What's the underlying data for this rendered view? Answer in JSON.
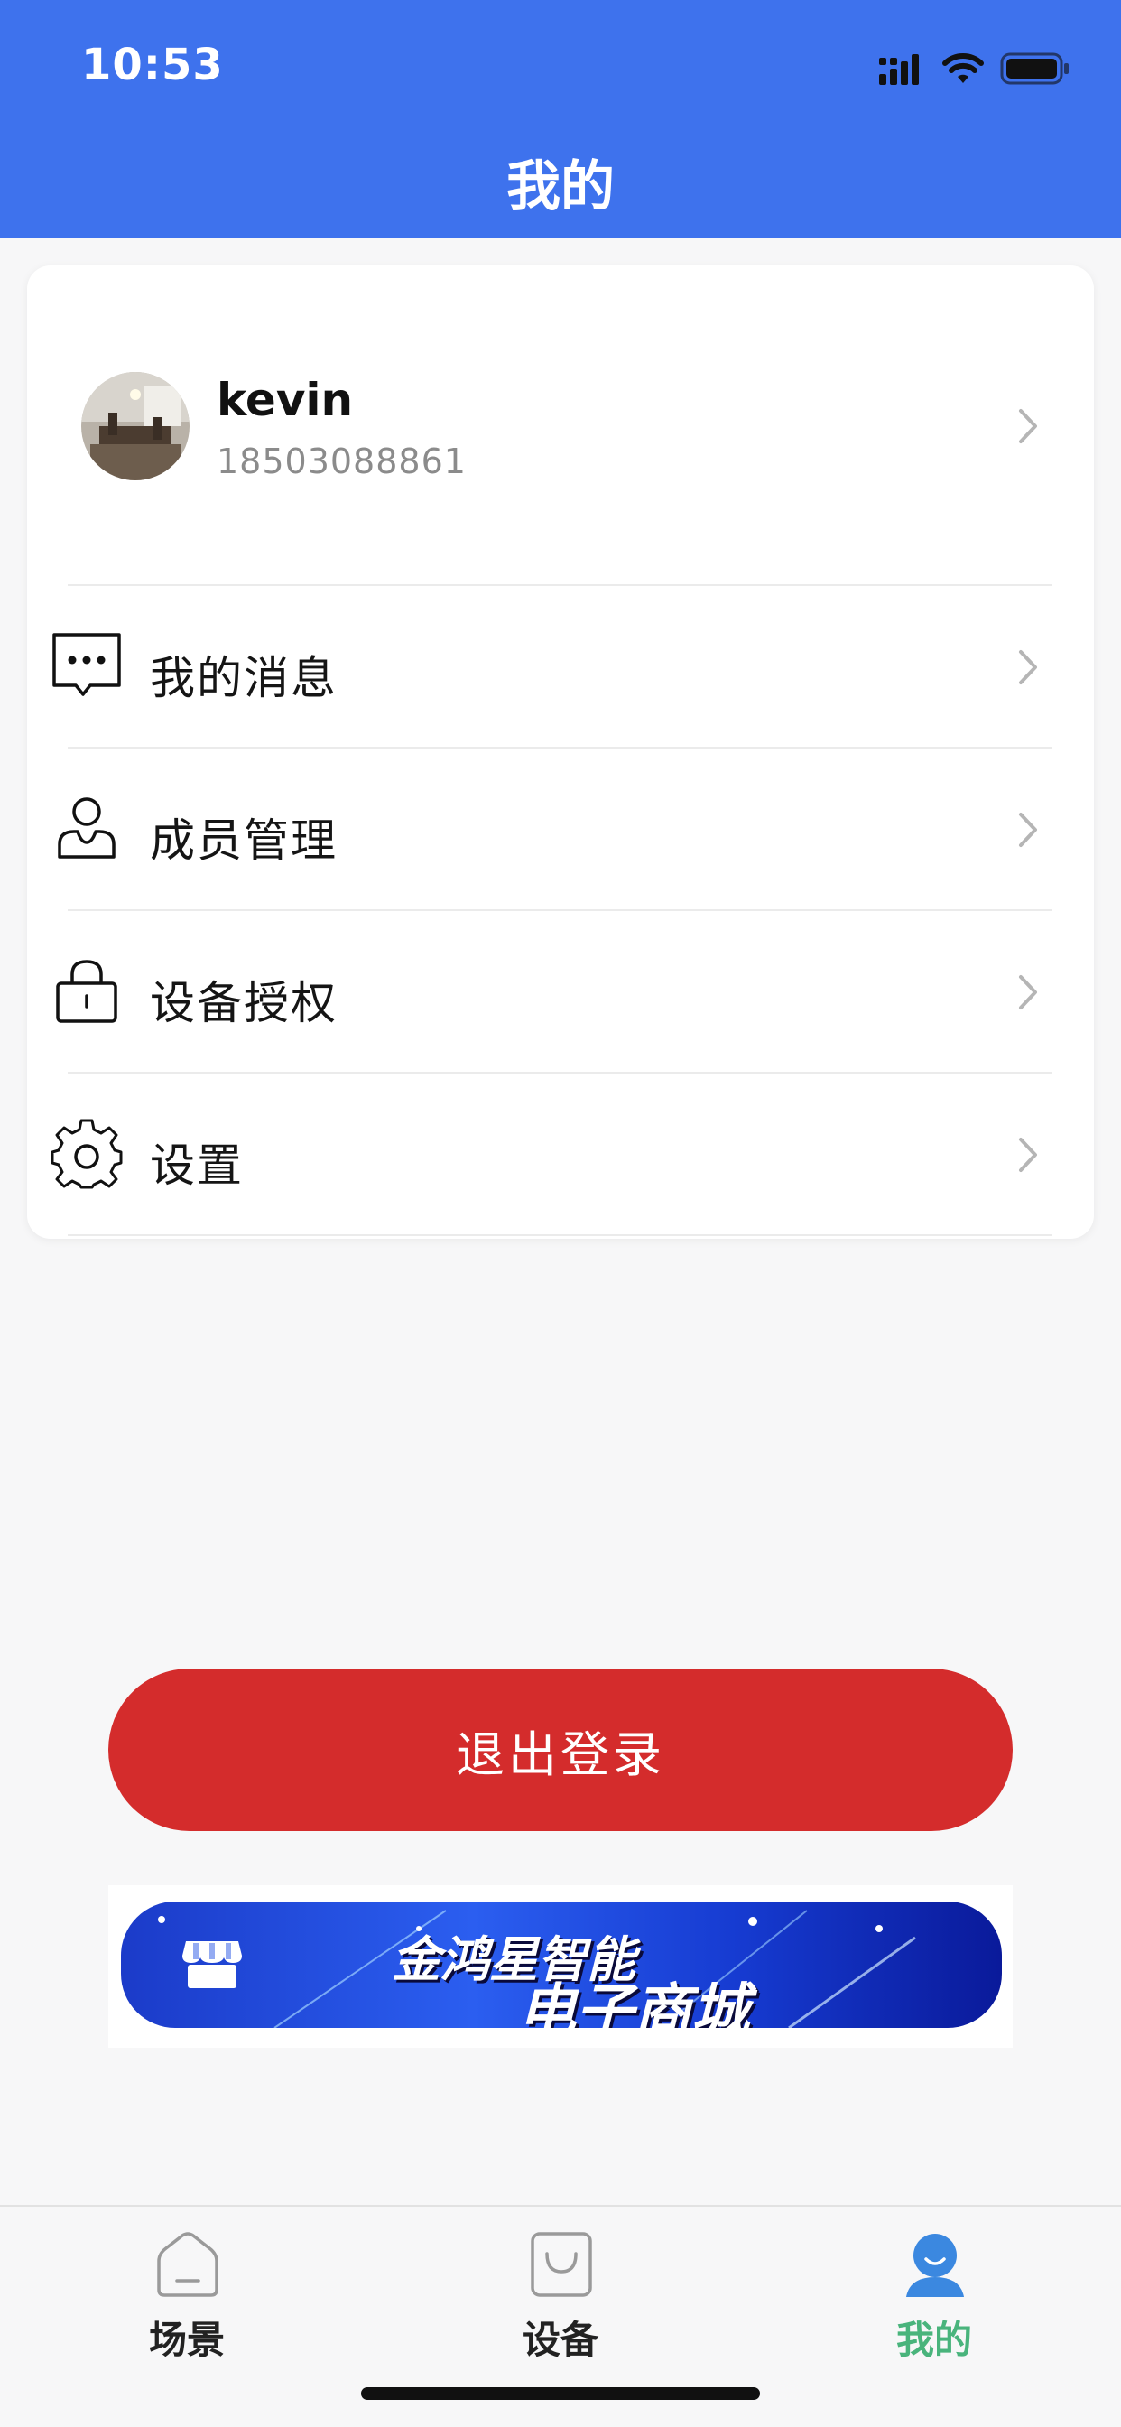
{
  "status_bar": {
    "time": "10:53"
  },
  "header": {
    "title": "我的"
  },
  "profile": {
    "username": "kevin",
    "phone": "18503088861"
  },
  "menu": [
    {
      "label": "我的消息",
      "icon": "message-icon"
    },
    {
      "label": "成员管理",
      "icon": "member-icon"
    },
    {
      "label": "设备授权",
      "icon": "lock-icon"
    },
    {
      "label": "设置",
      "icon": "gear-icon"
    }
  ],
  "logout_label": "退出登录",
  "banner": {
    "line1": "金鸿星智能",
    "line2": "电子商城"
  },
  "tabs": [
    {
      "label": "场景",
      "icon": "home-icon",
      "active": false
    },
    {
      "label": "设备",
      "icon": "bag-icon",
      "active": false
    },
    {
      "label": "我的",
      "icon": "user-icon",
      "active": true
    }
  ],
  "colors": {
    "header_bg": "#3e72ed",
    "logout_bg": "#d42c2c",
    "active_tab": "#49b47c"
  }
}
